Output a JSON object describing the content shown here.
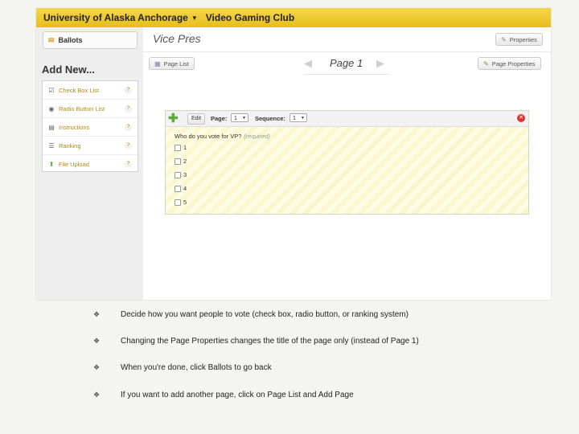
{
  "app": {
    "org_name": "University of Alaska Anchorage",
    "club_name": "Video Gaming Club"
  },
  "sidebar": {
    "ballots_label": "Ballots",
    "add_new_title": "Add New...",
    "items": [
      {
        "label": "Check Box List",
        "icon": "checkbox-list-icon",
        "help": "?"
      },
      {
        "label": "Radio Button List",
        "icon": "radio-list-icon",
        "help": "?"
      },
      {
        "label": "Instructions",
        "icon": "instructions-icon",
        "help": "?"
      },
      {
        "label": "Ranking",
        "icon": "ranking-icon",
        "help": "?"
      },
      {
        "label": "File Upload",
        "icon": "upload-icon",
        "help": "?"
      }
    ]
  },
  "main": {
    "page_title": "Vice Pres",
    "properties_label": "Properties",
    "page_list_label": "Page List",
    "page_properties_label": "Page Properties",
    "current_page": "Page 1"
  },
  "question_panel": {
    "edit_label": "Edit",
    "page_label": "Page:",
    "page_value": "1",
    "sequence_label": "Sequence:",
    "sequence_value": "1",
    "question_text": "Who do you vote for VP?",
    "required_text": "(required)",
    "options": [
      "1",
      "2",
      "3",
      "4",
      "5"
    ]
  },
  "notes": [
    "Decide how you want people to vote (check box, radio button, or ranking system)",
    "Changing the Page Properties changes the title of the page only (instead of Page 1)",
    "When you're done, click Ballots to go back",
    "If you want to add another page, click on Page List and Add Page"
  ],
  "colors": {
    "topbar": "#f2cd3a",
    "link": "#b58a10",
    "panel_bg": "#fefde4",
    "add_green": "#5cae3a",
    "delete_red": "#d33333"
  }
}
